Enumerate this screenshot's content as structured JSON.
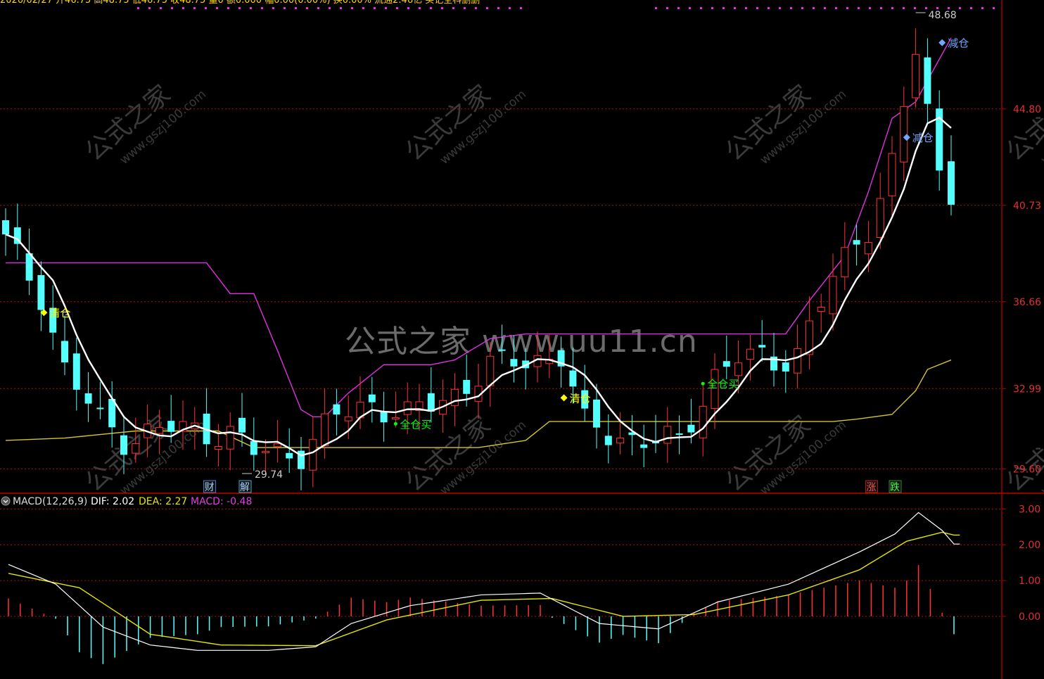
{
  "header": {
    "quote_text": "2020/02/27  开46.75 高48.75 低46.75 收48.75 量0 额0.000 幅0.00(0.00%) 换0.00% 流通2.46亿 买记全科删删",
    "quote_color": "#ffd700"
  },
  "watermarks": {
    "big": "公式之家 www.uu11.cn",
    "small_cn": "公式之家",
    "small_url": "www.gszj100.com"
  },
  "indicator": {
    "name": "MACD(12,26,9)",
    "dif_label": "DIF: 2.02",
    "dea_label": "DEA: 2.27",
    "macd_label": "MACD: -0.48",
    "toggle_icon": "circle-toggle-icon"
  },
  "colors": {
    "up": "#ff3232",
    "down": "#54ffff",
    "ma": "#ffffff",
    "upper_band": "#e030e0",
    "lower_band": "#d4c52a",
    "grid": "#b01010",
    "axis": "#c00000",
    "axis_text": "#e03030",
    "dif": "#ffffff",
    "dea": "#e5e500",
    "macd_pos": "#ff3232",
    "macd_neg": "#54ffff",
    "clear_signal": "#ffff00",
    "buy_signal": "#00ff00",
    "reduce_signal": "#6ea8ff"
  },
  "chart_data": [
    {
      "type": "candlestick",
      "title": "",
      "ylim": [
        28.6,
        49.4
      ],
      "y_ticks": [
        {
          "value": 44.8,
          "label": "44.80"
        },
        {
          "value": 40.73,
          "label": "40.73"
        },
        {
          "value": 36.66,
          "label": "36.66"
        },
        {
          "value": 32.99,
          "label": "32.99"
        },
        {
          "value": 29.6,
          "label": "29.60"
        }
      ],
      "candles": [
        [
          38.0,
          36.6,
          38.5,
          36.3
        ],
        [
          37.2,
          35.6,
          37.6,
          35.3
        ],
        [
          36.4,
          35.3,
          36.8,
          35.0
        ],
        [
          35.6,
          34.6,
          35.9,
          34.1
        ],
        [
          33.6,
          33.6,
          34.1,
          33.5
        ],
        [
          32.3,
          32.9,
          33.3,
          31.4
        ],
        [
          32.9,
          31.0,
          33.2,
          30.8
        ],
        [
          30.8,
          31.3,
          31.5,
          30.6
        ],
        [
          31.0,
          31.1,
          31.3,
          30.8
        ],
        [
          31.7,
          31.5,
          31.9,
          31.2
        ],
        [
          31.6,
          30.5,
          31.9,
          30.3
        ],
        [
          30.8,
          30.6,
          31.2,
          30.2
        ],
        [
          30.6,
          31.1,
          31.3,
          30.5
        ],
        [
          31.2,
          31.4,
          31.8,
          30.9
        ],
        [
          31.4,
          30.9,
          31.6,
          30.6
        ],
        [
          31.1,
          31.1,
          31.4,
          30.9
        ],
        [
          31.1,
          31.5,
          31.8,
          30.9
        ],
        [
          31.5,
          31.4,
          31.8,
          31.2
        ],
        [
          31.4,
          31.4,
          31.9,
          31.0
        ],
        [
          31.5,
          30.8,
          31.9,
          30.6
        ],
        [
          31.2,
          31.3,
          31.6,
          31.0
        ],
        [
          31.2,
          30.6,
          31.7,
          30.4
        ],
        [
          31.0,
          30.8,
          31.6,
          30.7
        ],
        [
          30.7,
          30.3,
          31.2,
          30.1
        ],
        [
          30.8,
          30.4,
          31.2,
          30.1
        ],
        [
          30.1,
          30.0,
          30.5,
          29.7
        ],
        [
          29.8,
          29.9,
          30.4,
          29.7
        ],
        [
          30.1,
          30.3,
          30.8,
          29.9
        ],
        [
          30.3,
          30.7,
          31.0,
          30.1
        ],
        [
          30.8,
          30.8,
          31.1,
          30.5
        ],
        [
          30.5,
          30.3,
          30.8,
          30.0
        ],
        [
          30.3,
          30.1,
          30.7,
          29.8
        ],
        [
          30.0,
          30.2,
          30.5,
          29.6
        ],
        [
          29.9,
          30.2,
          30.5,
          29.7
        ],
        [
          30.6,
          30.7,
          31.0,
          30.3
        ],
        [
          30.5,
          30.5,
          30.8,
          30.2
        ],
        [
          30.4,
          30.2,
          30.7,
          29.9
        ],
        [
          30.1,
          30.0,
          30.4,
          29.7
        ],
        [
          30.0,
          29.8,
          30.2,
          29.6
        ],
        [
          29.8,
          30.0,
          30.2,
          29.5
        ],
        [
          29.8,
          29.9,
          30.2,
          29.5
        ],
        [
          30.0,
          30.0,
          30.3,
          29.7
        ],
        [
          29.9,
          30.0,
          30.2,
          29.7
        ],
        [
          30.0,
          29.9,
          30.3,
          29.6
        ],
        [
          29.8,
          30.0,
          30.3,
          29.5
        ],
        [
          30.0,
          30.2,
          30.5,
          29.8
        ],
        [
          30.2,
          30.3,
          30.6,
          30.0
        ],
        [
          30.3,
          30.6,
          30.9,
          30.1
        ],
        [
          30.6,
          30.7,
          31.0,
          30.4
        ],
        [
          30.7,
          30.7,
          31.0,
          30.5
        ],
        [
          30.7,
          30.9,
          31.2,
          30.6
        ],
        [
          31.0,
          31.0,
          31.3,
          30.7
        ]
      ]
    },
    {
      "type": "bar+line",
      "title": "MACD(12,26,9)",
      "ylim": [
        -1.75,
        3.4
      ],
      "y_ticks": [
        {
          "value": 3.0,
          "label": "3.00"
        },
        {
          "value": 2.0,
          "label": "2.00"
        },
        {
          "value": 1.0,
          "label": "1.00"
        },
        {
          "value": 0.0,
          "label": "0.00"
        }
      ],
      "series": [
        {
          "name": "DIF"
        },
        {
          "name": "DEA"
        },
        {
          "name": "MACD"
        }
      ]
    }
  ],
  "annotations": {
    "high_price": "48.68",
    "low_price": "29.74",
    "clear_labels": [
      "清仓",
      "清仓"
    ],
    "buy_labels": [
      "全仓买",
      "全仓买"
    ],
    "reduce_labels": [
      "减仓",
      "减仓"
    ],
    "event_badges": [
      "财",
      "解",
      "涨",
      "跌"
    ]
  }
}
